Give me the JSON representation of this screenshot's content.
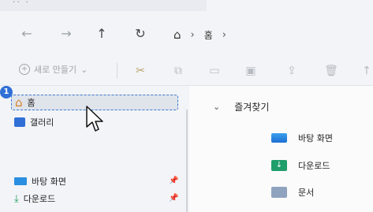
{
  "titlebar": {
    "dots": "·· ·"
  },
  "nav": {
    "back_icon": "back-arrow-icon",
    "forward_icon": "forward-arrow-icon",
    "up_icon": "up-arrow-icon",
    "refresh_icon": "refresh-icon",
    "breadcrumb": {
      "home_icon": "home-icon",
      "item": "홈"
    }
  },
  "toolbar": {
    "new_label": "새로 만들기",
    "icons": [
      "cut-icon",
      "copy-icon",
      "paste-icon",
      "rename-icon",
      "share-icon",
      "delete-icon",
      "sort-icon"
    ]
  },
  "sidebar": {
    "items": [
      {
        "label": "홈",
        "icon": "home-icon"
      },
      {
        "label": "갤러리",
        "icon": "gallery-icon"
      },
      {
        "label": "바탕 화면",
        "icon": "desktop-folder-icon",
        "pinned": true
      },
      {
        "label": "다운로드",
        "icon": "download-folder-icon",
        "pinned": true
      }
    ]
  },
  "content": {
    "group_title": "즐겨찾기",
    "favorites": [
      {
        "label": "바탕 화면",
        "icon": "desktop-folder-icon"
      },
      {
        "label": "다운로드",
        "icon": "download-folder-icon"
      },
      {
        "label": "문서",
        "icon": "documents-folder-icon"
      }
    ]
  },
  "annotation": {
    "step": "1"
  },
  "colors": {
    "accent": "#2f6fd6",
    "selection": "#dfe3ea",
    "home_icon": "#d9822b"
  }
}
